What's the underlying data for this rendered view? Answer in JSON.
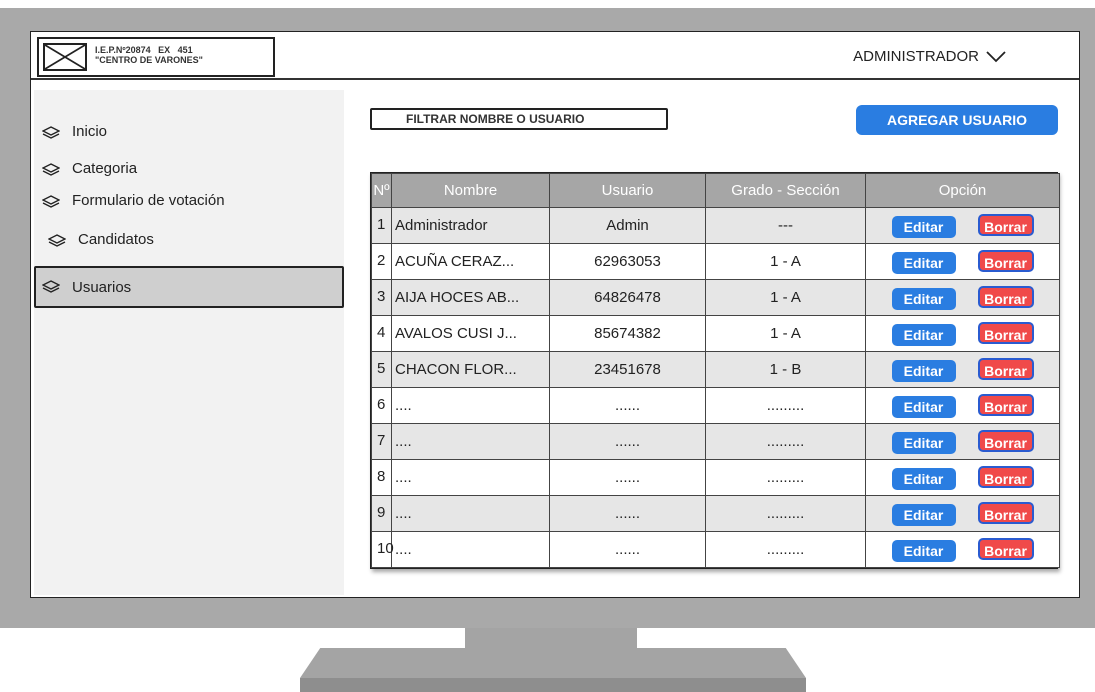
{
  "header": {
    "logo_line1": "I.E.P.Nº20874   EX   451",
    "logo_line2": "\"CENTRO DE VARONES\"",
    "user_menu_label": "ADMINISTRADOR"
  },
  "sidebar": {
    "items": [
      {
        "label": "Inicio",
        "icon": "layers-icon"
      },
      {
        "label": "Categoria",
        "icon": "layers-icon"
      },
      {
        "label": "Formulario de votación",
        "icon": "layers-icon"
      },
      {
        "label": "Candidatos",
        "icon": "layers-icon"
      },
      {
        "label": "Usuarios",
        "icon": "layers-icon",
        "active": true
      }
    ]
  },
  "toolbar": {
    "filter_placeholder": "FILTRAR  NOMBRE O USUARIO",
    "add_button_label": "AGREGAR USUARIO"
  },
  "table": {
    "columns": [
      "Nº",
      "Nombre",
      "Usuario",
      "Grado - Sección",
      "Opción"
    ],
    "edit_label": "Editar",
    "delete_label": "Borrar",
    "rows": [
      {
        "num": "1",
        "name": "Administrador",
        "user": "Admin",
        "grade": "---"
      },
      {
        "num": "2",
        "name": "ACUÑA CERAZ...",
        "user": "62963053",
        "grade": "1 - A"
      },
      {
        "num": "3",
        "name": "AIJA HOCES AB...",
        "user": "64826478",
        "grade": "1 - A"
      },
      {
        "num": "4",
        "name": "AVALOS CUSI J...",
        "user": "85674382",
        "grade": "1 - A"
      },
      {
        "num": "5",
        "name": "CHACON FLOR...",
        "user": "23451678",
        "grade": "1 - B"
      },
      {
        "num": "6",
        "name": "....",
        "user": "......",
        "grade": "........."
      },
      {
        "num": "7",
        "name": "....",
        "user": "......",
        "grade": "........."
      },
      {
        "num": "8",
        "name": "....",
        "user": "......",
        "grade": "........."
      },
      {
        "num": "9",
        "name": "....",
        "user": "......",
        "grade": "........."
      },
      {
        "num": "10",
        "name": "....",
        "user": "......",
        "grade": "........."
      }
    ]
  },
  "colors": {
    "accent": "#2a7de1",
    "danger": "#f04a4a",
    "header_bg": "#a6a6a6",
    "frame": "#a9a9a9"
  }
}
